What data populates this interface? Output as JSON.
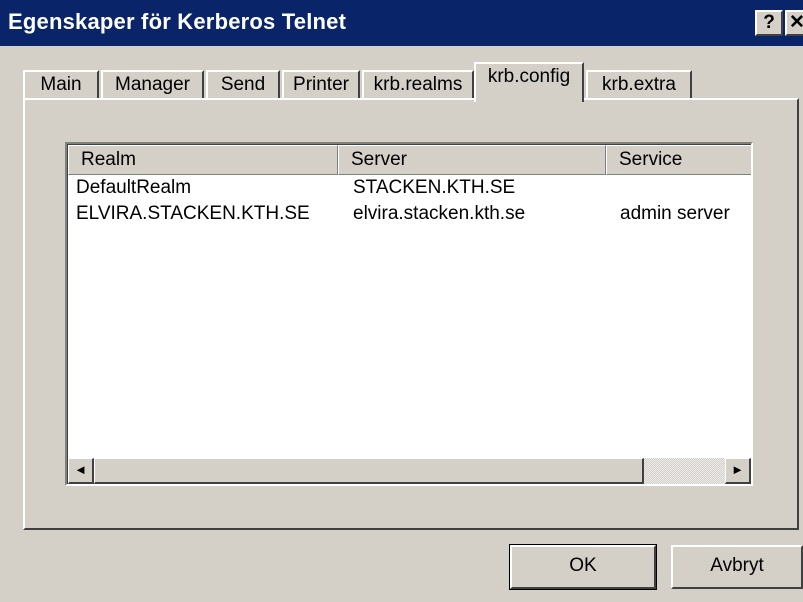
{
  "window": {
    "title": "Egenskaper för Kerberos Telnet",
    "help_label": "?",
    "close_label": "✕",
    "title_bar_color": "#0a246a"
  },
  "tabs": [
    {
      "label": "Main",
      "active": false
    },
    {
      "label": "Manager",
      "active": false
    },
    {
      "label": "Send",
      "active": false
    },
    {
      "label": "Printer",
      "active": false
    },
    {
      "label": "krb.realms",
      "active": false
    },
    {
      "label": "krb.config",
      "active": true
    },
    {
      "label": "krb.extra",
      "active": false
    }
  ],
  "list": {
    "columns": [
      "Realm",
      "Server",
      "Service"
    ],
    "rows": [
      [
        "DefaultRealm",
        "STACKEN.KTH.SE",
        ""
      ],
      [
        "ELVIRA.STACKEN.KTH.SE",
        "elvira.stacken.kth.se",
        "admin server"
      ]
    ],
    "scroll_left_icon": "◄",
    "scroll_right_icon": "►"
  },
  "buttons": {
    "ok": "OK",
    "cancel": "Avbryt"
  }
}
